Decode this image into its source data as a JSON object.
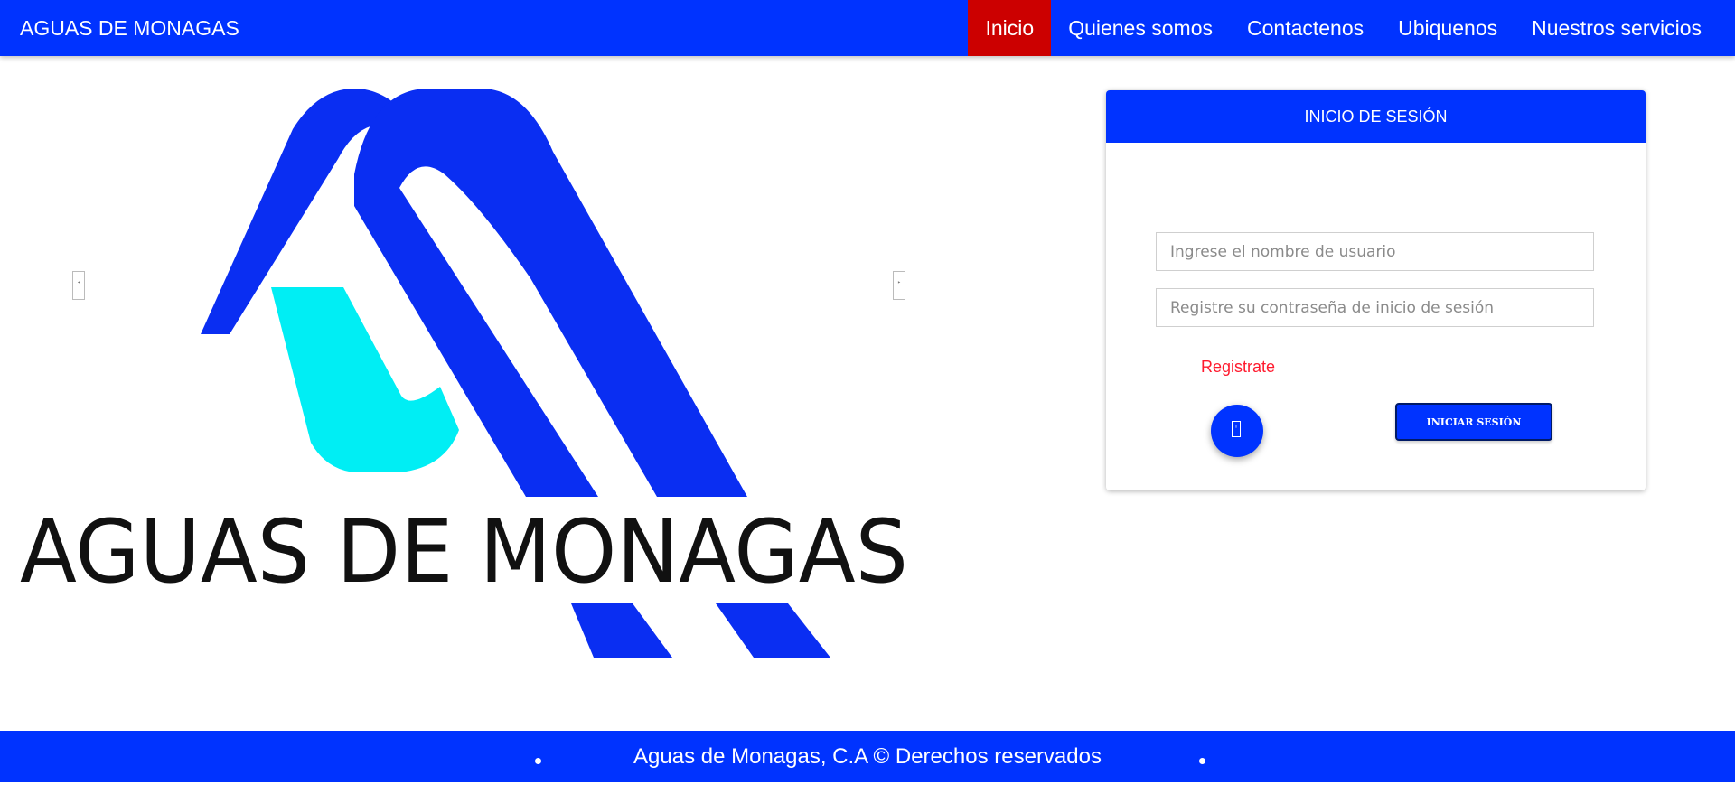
{
  "navbar": {
    "brand": "AGUAS DE MONAGAS",
    "items": [
      {
        "label": "Inicio",
        "active": true
      },
      {
        "label": "Quienes somos",
        "active": false
      },
      {
        "label": "Contactenos",
        "active": false
      },
      {
        "label": "Ubiquenos",
        "active": false
      },
      {
        "label": "Nuestros servicios",
        "active": false
      }
    ],
    "colors": {
      "background": "#0033ff",
      "active": "#cc0000"
    }
  },
  "carousel": {
    "slide_logo_text": "AGUAS DE MONAGAS",
    "logo_colors": {
      "primary": "#0a2ef2",
      "accent": "#00eef4",
      "text": "#111111"
    },
    "prev_icon": "chevron-left-icon",
    "next_icon": "chevron-right-icon"
  },
  "login": {
    "title": "INICIO DE SESIÓN",
    "username_placeholder": "Ingrese el nombre de usuario",
    "password_placeholder": "Registre su contraseña de inicio de sesión",
    "register_link": "Registrate",
    "fab_icon": "user-icon",
    "submit_label": "INICIAR SESIÓN"
  },
  "footer": {
    "text": "Aguas de Monagas, C.A © Derechos reservados"
  }
}
